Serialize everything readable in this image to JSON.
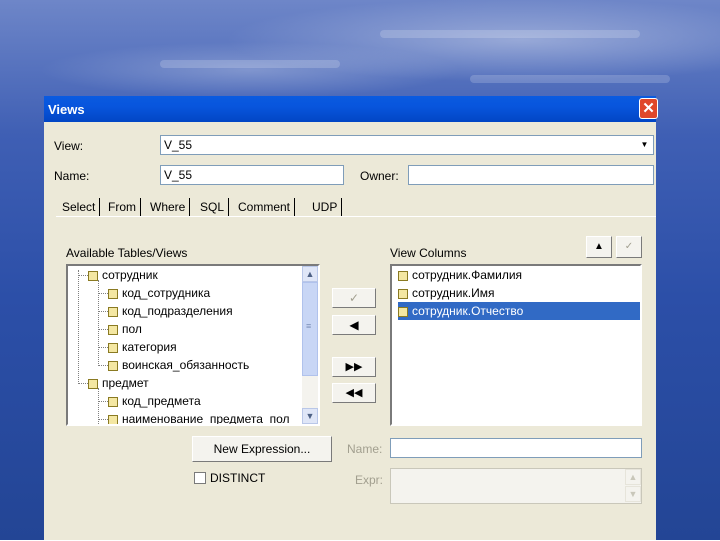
{
  "window": {
    "title": "Views",
    "close_glyph": "✕"
  },
  "form": {
    "view_label": "View:",
    "view_value": "V_55",
    "dropdown_glyph": "▼",
    "name_label": "Name:",
    "name_value": "V_55",
    "owner_label": "Owner:",
    "owner_value": ""
  },
  "tabs": [
    "Select",
    "From",
    "Where",
    "SQL",
    "Comment",
    "UDP"
  ],
  "available": {
    "label": "Available Tables/Views",
    "items": [
      {
        "label": "сотрудник",
        "level": 0
      },
      {
        "label": "код_сотрудника",
        "level": 1
      },
      {
        "label": "код_подразделения",
        "level": 1
      },
      {
        "label": "пол",
        "level": 1
      },
      {
        "label": "категория",
        "level": 1
      },
      {
        "label": "воинская_обязанность",
        "level": 1
      },
      {
        "label": "предмет",
        "level": 0
      },
      {
        "label": "код_предмета",
        "level": 1
      },
      {
        "label": "наименование_предмета_пол",
        "level": 1
      }
    ]
  },
  "view_columns": {
    "label": "View Columns",
    "items": [
      "сотрудник.Фамилия",
      "сотрудник.Имя",
      "сотрудник.Отчество"
    ],
    "selected_index": 2
  },
  "buttons": {
    "move_up": "▲",
    "move_down": "✓",
    "add": "✓",
    "remove": "◀",
    "add_all": "▶▶",
    "remove_all": "◀◀",
    "new_expression": "New Expression..."
  },
  "distinct_label": "DISTINCT",
  "name_field_label": "Name:",
  "name_field_value": "",
  "expr_label": "Expr:",
  "expr_value": "",
  "scroll": {
    "up": "▲",
    "down": "▼",
    "grip": "≡"
  }
}
